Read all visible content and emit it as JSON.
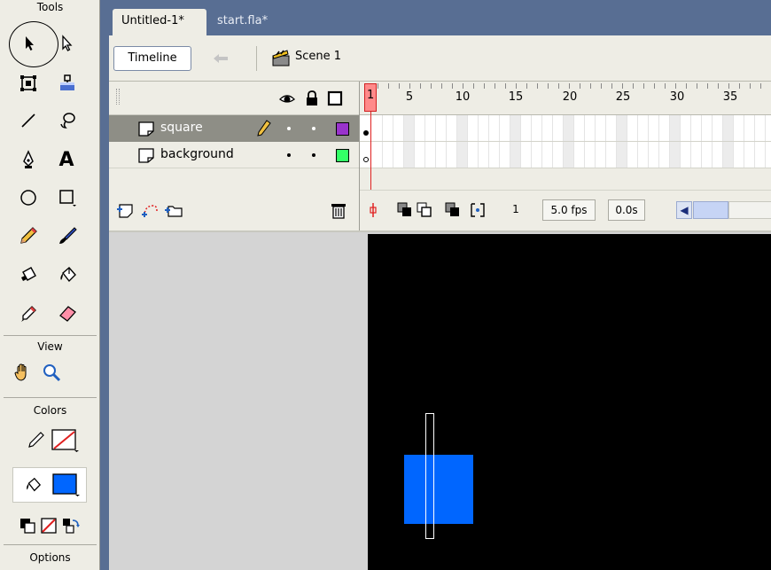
{
  "tools": {
    "title": "Tools",
    "view_title": "View",
    "colors_title": "Colors",
    "options_title": "Options",
    "items": [
      {
        "name": "selection-tool",
        "icon": "arrow-icon"
      },
      {
        "name": "subselection-tool",
        "icon": "hollow-arrow-icon"
      },
      {
        "name": "free-transform-tool",
        "icon": "transform-icon"
      },
      {
        "name": "fill-transform-tool",
        "icon": "gradient-transform-icon"
      },
      {
        "name": "line-tool",
        "icon": "line-icon"
      },
      {
        "name": "lasso-tool",
        "icon": "lasso-icon"
      },
      {
        "name": "pen-tool",
        "icon": "pen-icon"
      },
      {
        "name": "text-tool",
        "icon": "text-icon"
      },
      {
        "name": "oval-tool",
        "icon": "oval-icon"
      },
      {
        "name": "rectangle-tool",
        "icon": "rectangle-icon"
      },
      {
        "name": "pencil-tool",
        "icon": "pencil-icon"
      },
      {
        "name": "brush-tool",
        "icon": "brush-icon"
      },
      {
        "name": "ink-bottle-tool",
        "icon": "ink-bottle-icon"
      },
      {
        "name": "paint-bucket-tool",
        "icon": "paint-bucket-icon"
      },
      {
        "name": "eyedropper-tool",
        "icon": "eyedropper-icon"
      },
      {
        "name": "eraser-tool",
        "icon": "eraser-icon"
      },
      {
        "name": "hand-tool",
        "icon": "hand-icon"
      },
      {
        "name": "zoom-tool",
        "icon": "magnifier-icon"
      }
    ],
    "text_tool_glyph": "A",
    "stroke_color": "none",
    "fill_color": "#0066ff"
  },
  "document": {
    "tabs": [
      {
        "label": "Untitled-1*",
        "active": true
      },
      {
        "label": "start.fla*",
        "active": false
      }
    ],
    "timeline_button": "Timeline",
    "scene_label": "Scene 1"
  },
  "timeline": {
    "layers": [
      {
        "name": "square",
        "selected": true,
        "outline_color": "#9933cc"
      },
      {
        "name": "background",
        "selected": false,
        "outline_color": "#33ff66"
      }
    ],
    "frame_numbers": [
      "1",
      "5",
      "10",
      "15",
      "20",
      "25",
      "30",
      "35"
    ],
    "current_frame": "1",
    "frame_rate": "5.0 fps",
    "elapsed_time": "0.0s"
  },
  "stage": {
    "background_color": "#000000",
    "square_color": "#0066ff"
  }
}
